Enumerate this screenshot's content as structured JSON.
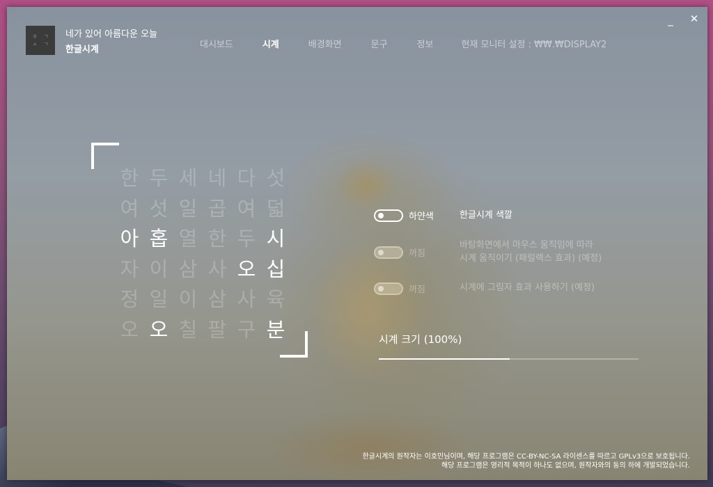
{
  "app": {
    "logo_glyphs": [
      "ㅎ",
      "ㄱ",
      "ㅅ",
      "ㄱ"
    ],
    "subtitle": "네가 있어 아름다운 오늘",
    "title": "한글시계"
  },
  "nav": {
    "items": [
      {
        "label": "대시보드",
        "active": false
      },
      {
        "label": "시계",
        "active": true
      },
      {
        "label": "배경화면",
        "active": false
      },
      {
        "label": "문구",
        "active": false
      },
      {
        "label": "정보",
        "active": false
      }
    ],
    "monitor": "현재 모니터 설정 : ₩₩.₩DISPLAY2"
  },
  "window_controls": {
    "minimize": "_",
    "close": "✕"
  },
  "clock": {
    "rows": [
      [
        "한",
        "두",
        "세",
        "네",
        "다",
        "섯"
      ],
      [
        "여",
        "섯",
        "일",
        "곱",
        "여",
        "덟"
      ],
      [
        "아",
        "홉",
        "열",
        "한",
        "두",
        "시"
      ],
      [
        "자",
        "이",
        "삼",
        "사",
        "오",
        "십"
      ],
      [
        "정",
        "일",
        "이",
        "삼",
        "사",
        "육"
      ],
      [
        "오",
        "오",
        "칠",
        "팔",
        "구",
        "분"
      ]
    ],
    "lit": [
      [
        2,
        0
      ],
      [
        2,
        1
      ],
      [
        2,
        5
      ],
      [
        3,
        4
      ],
      [
        3,
        5
      ],
      [
        5,
        1
      ],
      [
        5,
        5
      ]
    ]
  },
  "settings": {
    "white_color": {
      "label": "하얀색",
      "description": "한글시계 색깔",
      "enabled": true
    },
    "parallax": {
      "label": "꺼짐",
      "description_line1": "바탕화면에서 마우스 움직임에 따라",
      "description_line2": "시계 움직이기 (패럴렉스 효과) (예정)",
      "enabled": false
    },
    "shadow": {
      "label": "꺼짐",
      "description": "시계에 그림자 효과 사용하기 (예정)",
      "enabled": false
    },
    "size": {
      "label": "시계 크기 (100%)",
      "fraction": 0.505
    }
  },
  "footer": {
    "line1": "한글시계의 원작자는 이호민님이며, 해당 프로그램은 CC-BY-NC-SA 라이센스를 따르고 GPLv3으로 보호됩니다.",
    "line2": "해당 프로그램은 영리적 목적이 하나도 없으며, 원작자와의 동의 하에 개발되었습니다."
  }
}
